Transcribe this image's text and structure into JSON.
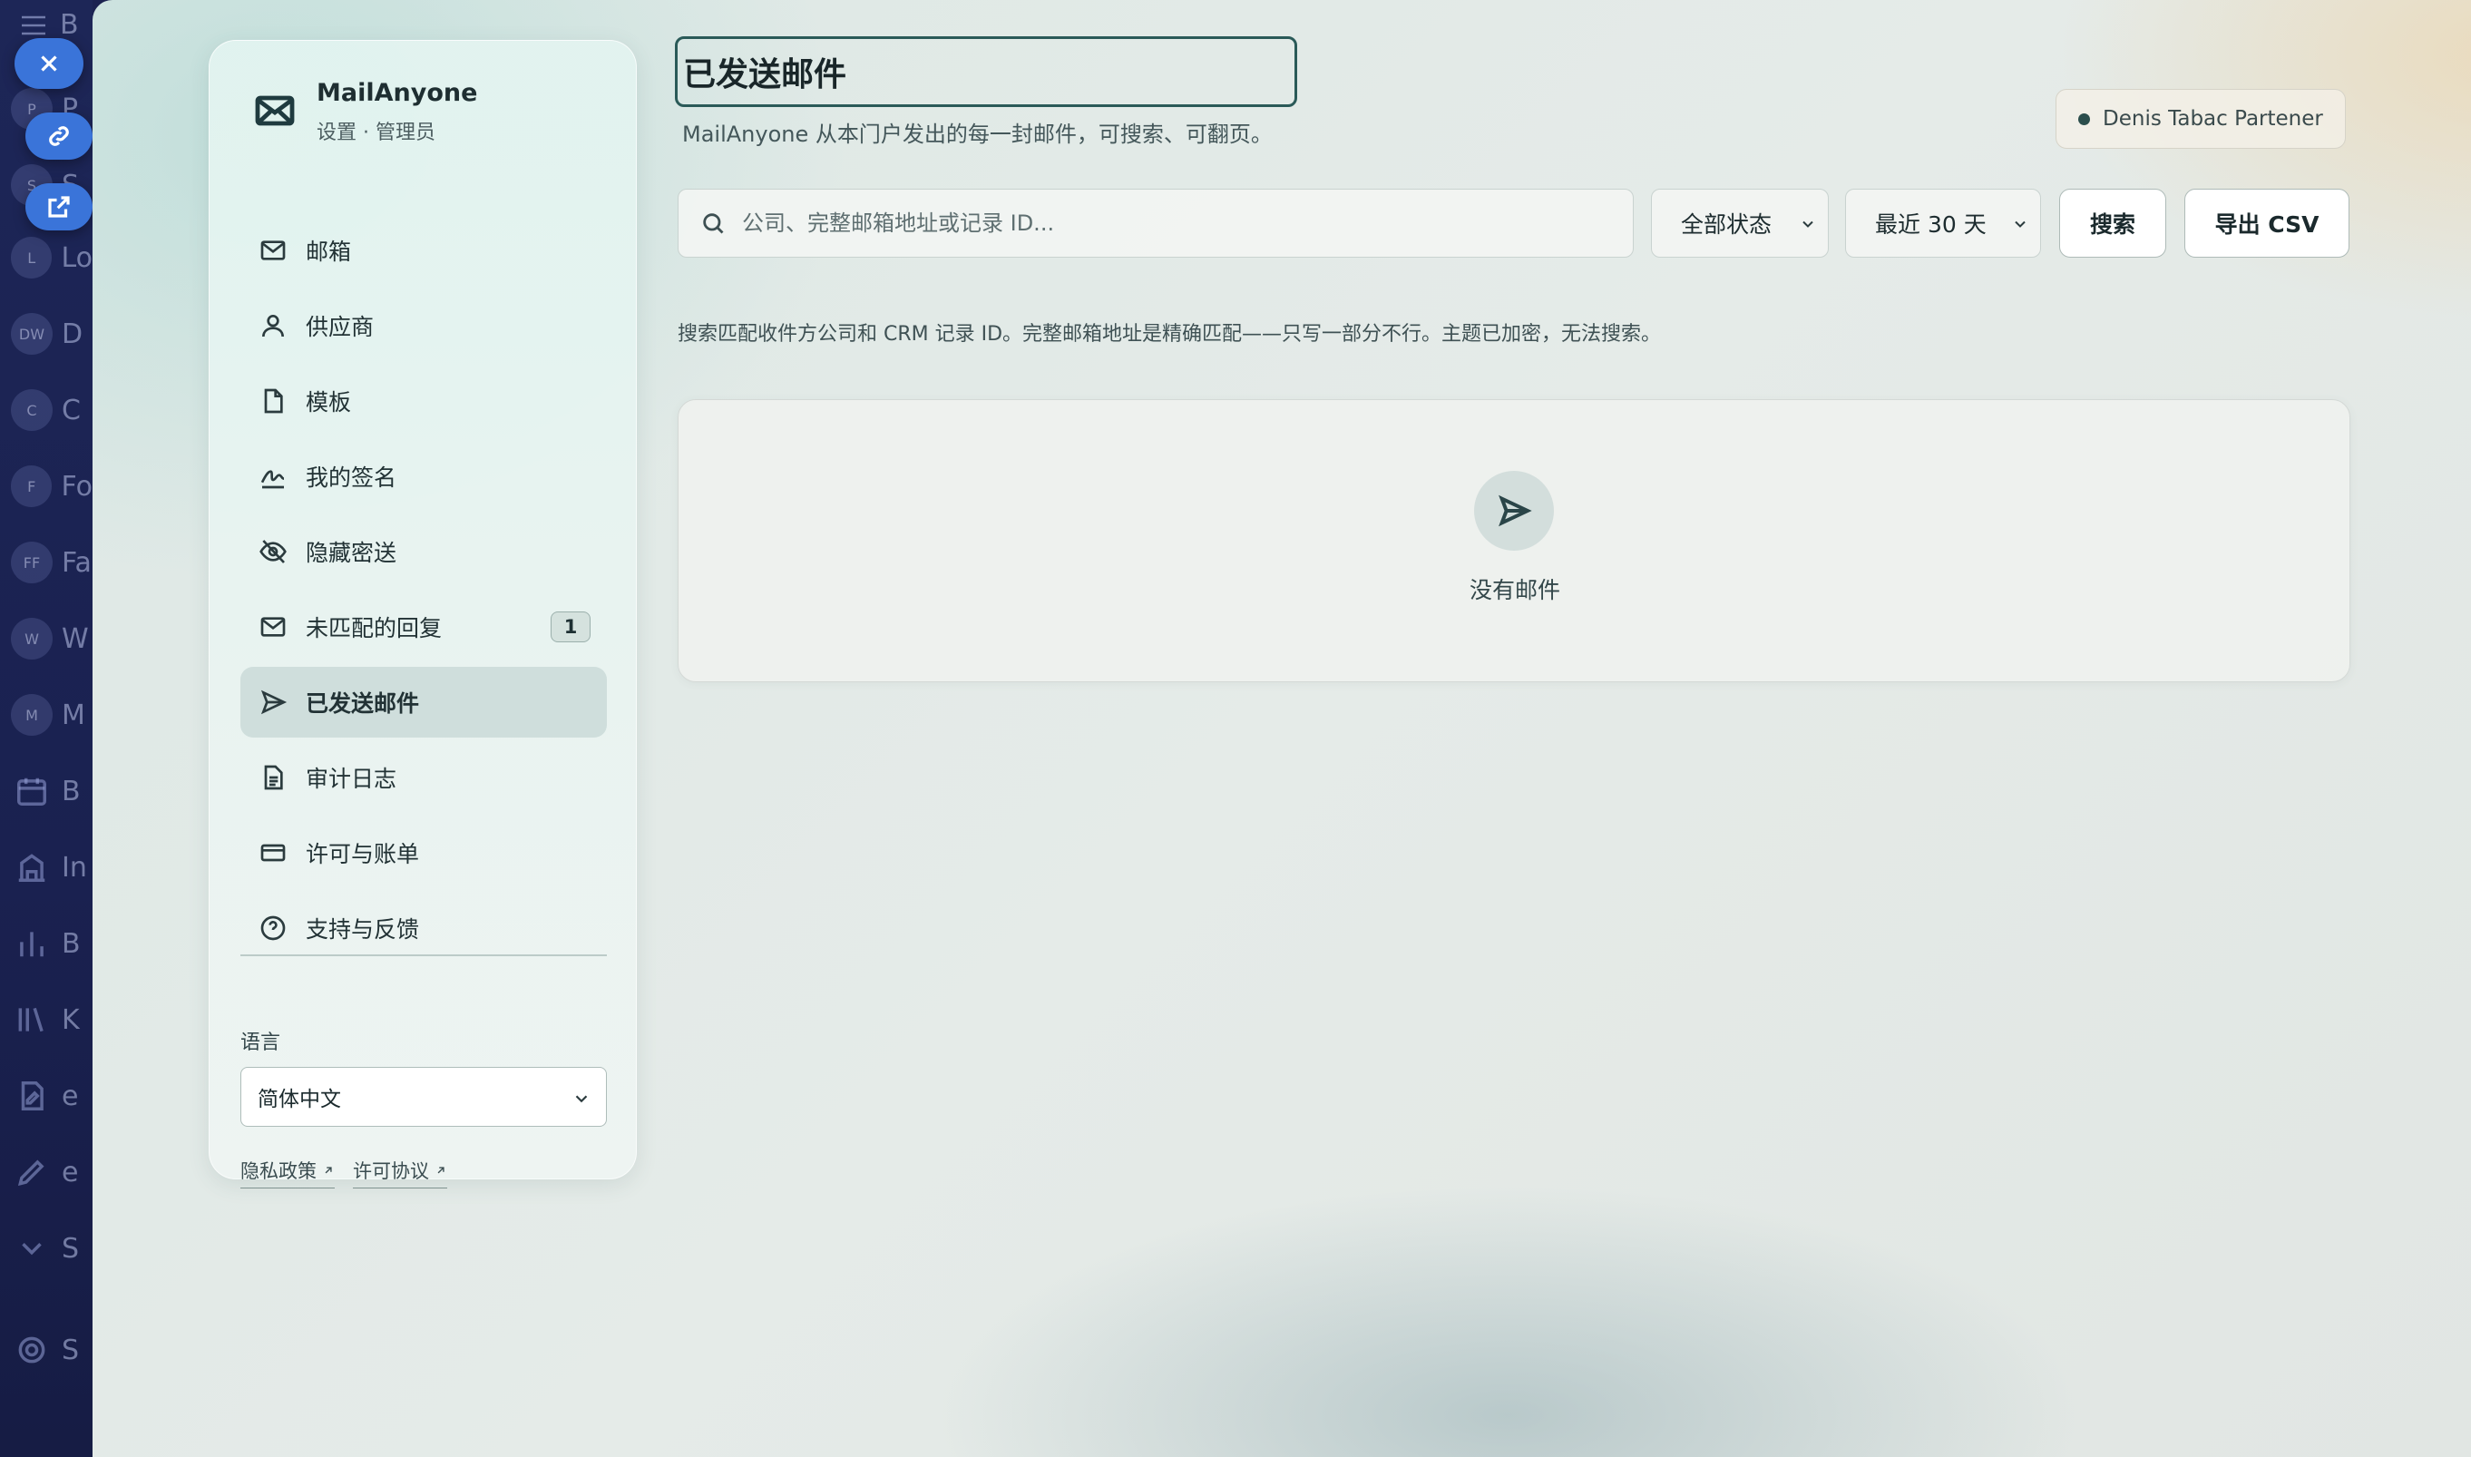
{
  "host": {
    "header_letter": "B",
    "rows": [
      {
        "avatar": "P",
        "text": "P"
      },
      {
        "avatar": "S",
        "text": "S"
      },
      {
        "avatar": "L",
        "text": "Lo"
      },
      {
        "avatar": "DW",
        "text": "D"
      },
      {
        "avatar": "C",
        "text": "C"
      },
      {
        "avatar": "F",
        "text": "Fo"
      },
      {
        "avatar": "FF",
        "text": "Fa"
      },
      {
        "avatar": "W",
        "text": "W"
      },
      {
        "avatar": "M",
        "text": "M"
      }
    ],
    "icon_rows": [
      "B",
      "In",
      "B",
      "K",
      "e",
      "e",
      "S",
      "S"
    ]
  },
  "sidebar": {
    "app_name": "MailAnyone",
    "subtitle": "设置 · 管理员",
    "items": [
      {
        "label": "邮箱",
        "icon": "mail-icon"
      },
      {
        "label": "供应商",
        "icon": "user-icon"
      },
      {
        "label": "模板",
        "icon": "file-icon"
      },
      {
        "label": "我的签名",
        "icon": "signature-icon"
      },
      {
        "label": "隐藏密送",
        "icon": "eye-off-icon"
      },
      {
        "label": "未匹配的回复",
        "icon": "mail-icon",
        "badge": "1"
      },
      {
        "label": "已发送邮件",
        "icon": "send-icon",
        "active": true
      },
      {
        "label": "审计日志",
        "icon": "document-icon"
      },
      {
        "label": "许可与账单",
        "icon": "credit-card-icon"
      },
      {
        "label": "支持与反馈",
        "icon": "help-icon"
      }
    ],
    "language_label": "语言",
    "language_value": "简体中文",
    "privacy_link": "隐私政策",
    "license_link": "许可协议"
  },
  "main": {
    "title": "已发送邮件",
    "subtitle": "MailAnyone 从本门户发出的每一封邮件，可搜索、可翻页。",
    "user_name": "Denis Tabac Partener",
    "search_placeholder": "公司、完整邮箱地址或记录 ID...",
    "status_filter": "全部状态",
    "date_filter": "最近 30 天",
    "search_button": "搜索",
    "export_button": "导出 CSV",
    "hint": "搜索匹配收件方公司和 CRM 记录 ID。完整邮箱地址是精确匹配——只写一部分不行。主题已加密，无法搜索。",
    "empty_text": "没有邮件"
  },
  "colors": {
    "accent": "#2a5a58",
    "active_nav": "#cfdedc",
    "host_bg": "#1b2250",
    "host_button": "#3a74d9"
  }
}
